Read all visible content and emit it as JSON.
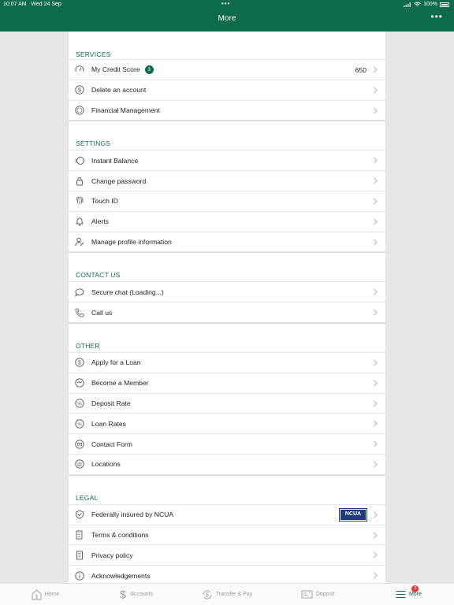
{
  "status": {
    "time": "10:07 AM",
    "date": "Wed 24 Sep",
    "battery": "100%"
  },
  "header": {
    "title": "More"
  },
  "sections": {
    "services": {
      "title": "SERVICES",
      "items": [
        {
          "label": "My Credit Score",
          "badge": "3",
          "value": "650"
        },
        {
          "label": "Delete an account"
        },
        {
          "label": "Financial Management"
        }
      ]
    },
    "settings": {
      "title": "SETTINGS",
      "items": [
        {
          "label": "Instant Balance"
        },
        {
          "label": "Change password"
        },
        {
          "label": "Touch ID"
        },
        {
          "label": "Alerts"
        },
        {
          "label": "Manage profile information"
        }
      ]
    },
    "contact": {
      "title": "CONTACT US",
      "items": [
        {
          "label": "Secure chat (Loading...)"
        },
        {
          "label": "Call us"
        }
      ]
    },
    "other": {
      "title": "OTHER",
      "items": [
        {
          "label": "Apply for a Loan"
        },
        {
          "label": "Become a Member"
        },
        {
          "label": "Deposit Rate"
        },
        {
          "label": "Loan Rates"
        },
        {
          "label": "Contact Form"
        },
        {
          "label": "Locations"
        }
      ]
    },
    "legal": {
      "title": "LEGAL",
      "items": [
        {
          "label": "Federally insured by NCUA",
          "logo_text": "NCUA"
        },
        {
          "label": "Terms & conditions"
        },
        {
          "label": "Privacy policy"
        },
        {
          "label": "Acknowledgements"
        }
      ]
    }
  },
  "tabbar": {
    "tabs": [
      {
        "label": "Home"
      },
      {
        "label": "Accounts"
      },
      {
        "label": "Transfer & Pay"
      },
      {
        "label": "Deposit"
      },
      {
        "label": "More",
        "badge": "3"
      }
    ]
  },
  "colors": {
    "brand": "#0e6b4a",
    "badge_red": "#e53935",
    "ncua_blue": "#1d3d7a"
  }
}
